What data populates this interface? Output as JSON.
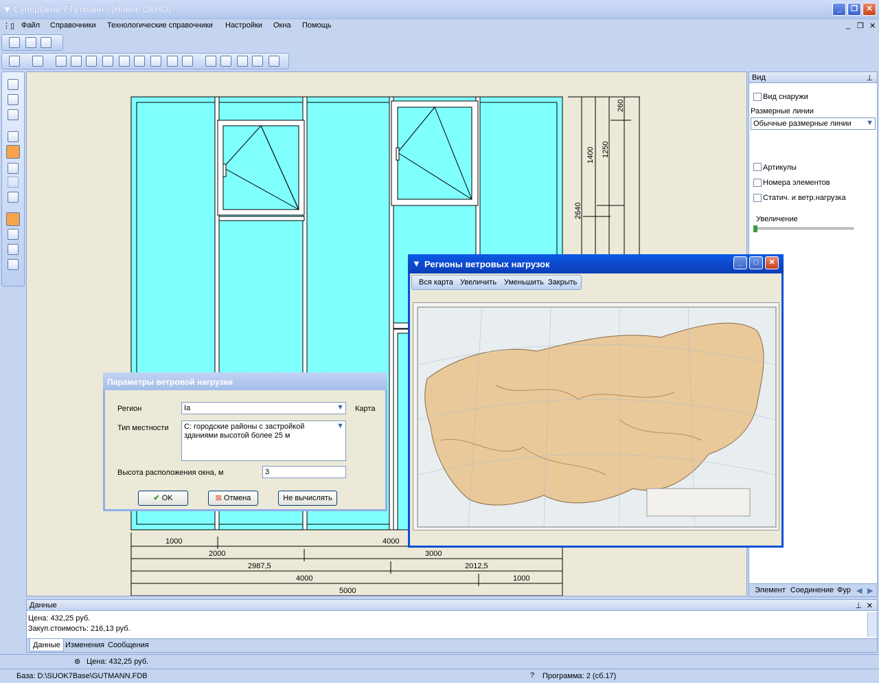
{
  "app": {
    "title": "СуперОкна 7 Гутманн - [Новое ОКНО]"
  },
  "menu": [
    "Файл",
    "Справочники",
    "Технологические справочники",
    "Настройки",
    "Окна",
    "Помощь"
  ],
  "drawing": {
    "dims_right": [
      "260",
      "1250",
      "1400",
      "2640"
    ],
    "dims_bottom": {
      "r1a": "1000",
      "r1b": "4000",
      "r2a": "2000",
      "r2b": "3000",
      "r3a": "2987,5",
      "r3b": "2012,5",
      "r4a": "4000",
      "r4b": "1000",
      "r5": "5000"
    }
  },
  "view_panel": {
    "title": "Вид",
    "outside_view": "Вид снаружи",
    "dim_lines_label": "Размерные линии",
    "dim_lines_value": "Обычные размерные линии",
    "articles": "Артикулы",
    "element_numbers": "Номера элементов",
    "static_load": "Статич. и ветр.нагрузка",
    "zoom_label": "Увеличение",
    "zoom_level": 0.0,
    "tabs": [
      "Элемент",
      "Соединение",
      "Фур"
    ]
  },
  "data_panel": {
    "title": "Данные",
    "line1": "Цена: 432,25 руб.",
    "line2": "Закуп.стоимость: 216,13 руб.",
    "tabs": [
      "Данные",
      "Изменения",
      "Сообщения"
    ]
  },
  "status": {
    "price": "Цена: 432,25 руб.",
    "base": "База: D:\\SUOK7Base\\GUTMANN.FDB",
    "program": "Программа: 2 (сб.17)"
  },
  "wind_dialog": {
    "title": "Параметры ветровой нагрузки",
    "region_label": "Регион",
    "region_value": "Ia",
    "map_link": "Карта",
    "terrain_label": "Тип местности",
    "terrain_value": "С: городские районы с застройкой зданиями высотой более 25 м",
    "height_label": "Высота расположения окна, м",
    "height_value": "3",
    "ok": "OK",
    "cancel": "Отмена",
    "no_calc": "Не вычислять"
  },
  "map_dialog": {
    "title": "Регионы ветровых нагрузок",
    "toolbar": [
      "Вся карта",
      "Увеличить",
      "Уменьшить",
      "Закрыть"
    ]
  },
  "colors": {
    "glass": "#80ffff",
    "accent": "#0a4fd6"
  }
}
